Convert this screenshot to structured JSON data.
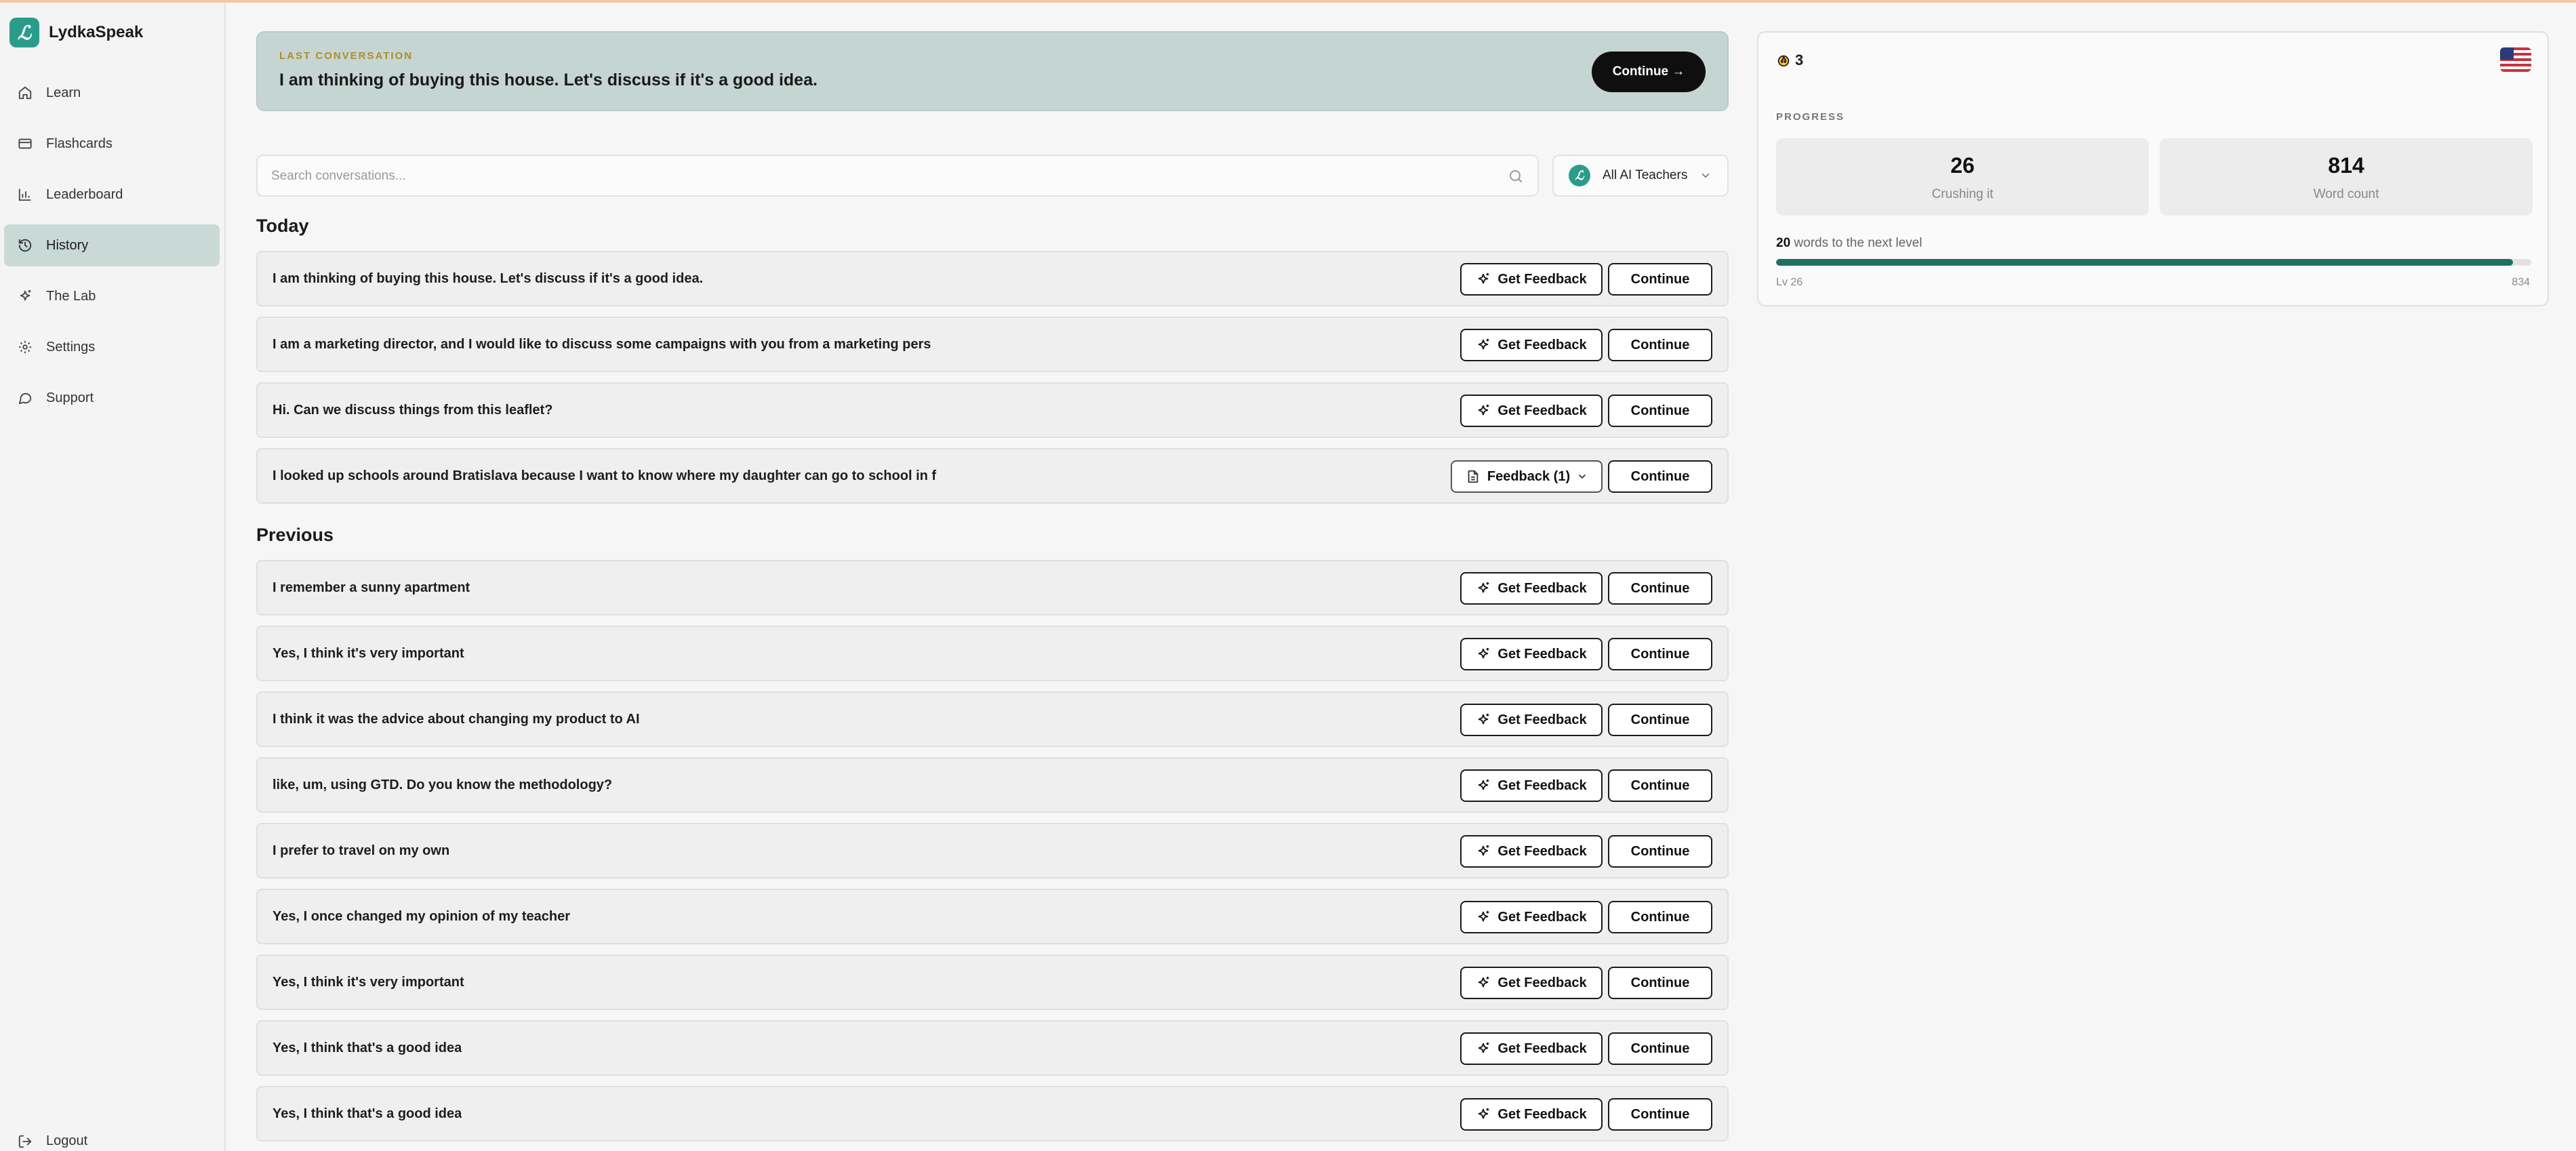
{
  "app": {
    "name": "LydkaSpeak",
    "logo_glyph": "ℒ"
  },
  "sidebar": {
    "items": [
      {
        "label": "Learn",
        "icon": "home-icon"
      },
      {
        "label": "Flashcards",
        "icon": "card-icon"
      },
      {
        "label": "Leaderboard",
        "icon": "chart-icon"
      },
      {
        "label": "History",
        "icon": "history-icon",
        "active": true
      },
      {
        "label": "The Lab",
        "icon": "sparkle-icon"
      },
      {
        "label": "Settings",
        "icon": "gear-icon"
      },
      {
        "label": "Support",
        "icon": "chat-icon"
      }
    ],
    "logout_label": "Logout"
  },
  "last_conversation": {
    "kicker": "LAST CONVERSATION",
    "title": "I am thinking of buying this house. Let's discuss if it's a good idea.",
    "continue_label": "Continue →"
  },
  "search": {
    "placeholder": "Search conversations...",
    "value": ""
  },
  "teacher_filter": {
    "label": "All AI Teachers",
    "avatar_glyph": "ℒ"
  },
  "sections": {
    "today_title": "Today",
    "previous_title": "Previous"
  },
  "buttons": {
    "get_feedback": "Get Feedback",
    "continue": "Continue",
    "feedback_open": "Feedback (1)"
  },
  "today": [
    {
      "text": "I am thinking of buying this house. Let's discuss if it's a good idea."
    },
    {
      "text": "I am a marketing director, and I would like to discuss some campaigns with you from a marketing pers"
    },
    {
      "text": "Hi. Can we discuss things from this leaflet?"
    },
    {
      "text": "I looked up schools around Bratislava because I want to know where my daughter can go to school in f"
    }
  ],
  "previous": [
    {
      "text": "I remember a sunny apartment"
    },
    {
      "text": "Yes, I think it's very important"
    },
    {
      "text": "I think it was the advice about changing my product to AI"
    },
    {
      "text": "like, um, using GTD. Do you know the methodology?"
    },
    {
      "text": "I prefer to travel on my own"
    },
    {
      "text": "Yes, I once changed my opinion of my teacher"
    },
    {
      "text": "Yes, I think it's very important"
    },
    {
      "text": "Yes, I think that's a good idea"
    },
    {
      "text": "Yes, I think that's a good idea"
    }
  ],
  "panel": {
    "streak": "3",
    "progress_label": "PROGRESS",
    "level_value": "26",
    "level_label": "Crushing it",
    "word_count_value": "814",
    "word_count_label": "Word count",
    "next_level_count": "20",
    "next_level_text": "words to the next level",
    "level_start": "Lv 26",
    "level_end": "834",
    "progress_fraction": 0.976
  },
  "colors": {
    "brand": "#2b9c8c",
    "active_nav": "#c9d9d6",
    "banner": "#c5d5d2",
    "kicker": "#b08b2c",
    "progress_fill": "#1f6f62"
  }
}
